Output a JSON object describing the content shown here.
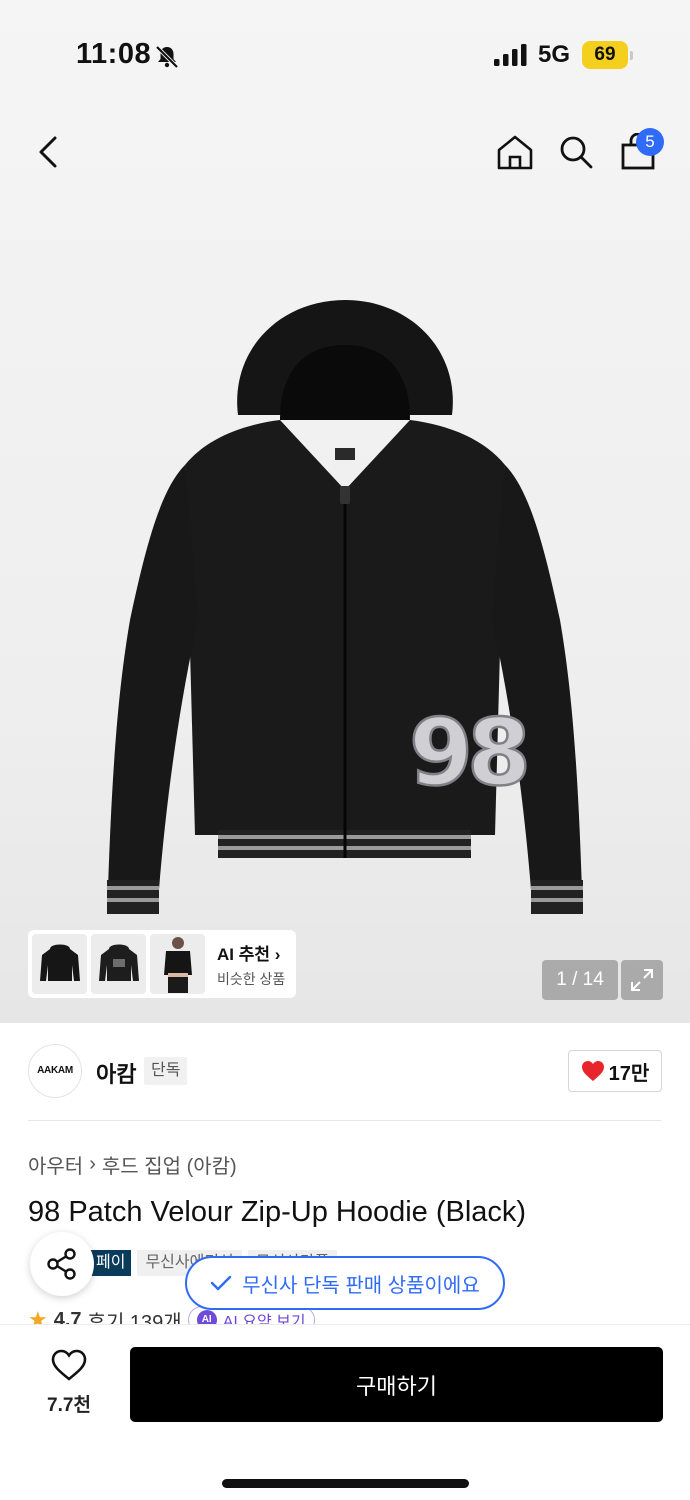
{
  "status_bar": {
    "time": "11:08",
    "network": "5G",
    "battery": "69"
  },
  "nav": {
    "cart_count": "5"
  },
  "gallery": {
    "jersey_number": "98",
    "ai_recommend_title": "AI 추천",
    "ai_recommend_subtitle": "비슷한 상품",
    "page_counter": "1 / 14"
  },
  "brand": {
    "logo_text": "AAKAM",
    "name": "아캄",
    "badge": "단독",
    "likes": "17만"
  },
  "breadcrumb": {
    "category": "아우터",
    "subcategory": "후드 집업 (아캄)"
  },
  "product": {
    "title": "98 Patch Velour Zip-Up Hoodie (Black)"
  },
  "tags": [
    "페이",
    "무신사에디션",
    "무신사라플"
  ],
  "rating": {
    "score": "4.7",
    "reviews": "후기 139개",
    "ai_badge": "AI",
    "ai_summary": "AI 요약 보기"
  },
  "toast": {
    "message": "무신사 단독 판매 상품이에요"
  },
  "bottom_bar": {
    "wishlist_count": "7.7천",
    "buy_label": "구매하기"
  },
  "colors": {
    "accent_blue": "#2f6bf6",
    "like_red": "#e8242c",
    "buy_black": "#000000"
  }
}
